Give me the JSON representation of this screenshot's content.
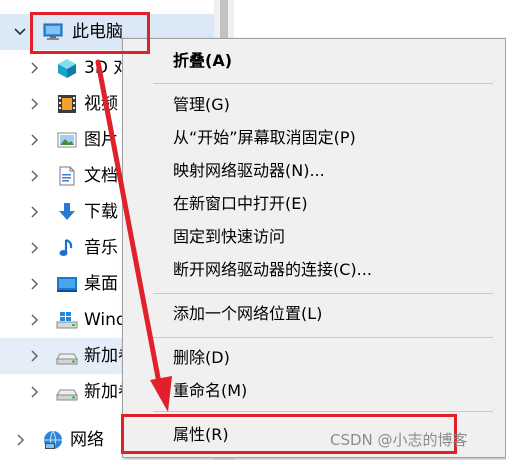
{
  "nav_tree": {
    "root": {
      "label": "此电脑",
      "icon": "computer-icon"
    },
    "items": [
      {
        "label": "3D 对象",
        "icon": "3d-objects-icon"
      },
      {
        "label": "视频",
        "icon": "video-icon"
      },
      {
        "label": "图片",
        "icon": "pictures-icon"
      },
      {
        "label": "文档",
        "icon": "documents-icon"
      },
      {
        "label": "下载",
        "icon": "download-icon"
      },
      {
        "label": "音乐",
        "icon": "music-icon"
      },
      {
        "label": "桌面",
        "icon": "desktop-icon"
      },
      {
        "label": "Windows",
        "icon": "windows-drive-icon"
      },
      {
        "label": "新加卷",
        "icon": "drive-icon"
      },
      {
        "label": "新加卷",
        "icon": "drive-icon"
      }
    ],
    "network": {
      "label": "网络",
      "icon": "network-icon"
    }
  },
  "context_menu": {
    "collapse": "折叠(A)",
    "manage": "管理(G)",
    "unpin_start": "从“开始”屏幕取消固定(P)",
    "map_drive": "映射网络驱动器(N)...",
    "open_new_window": "在新窗口中打开(E)",
    "pin_quick_access": "固定到快速访问",
    "disconnect_drive": "断开网络驱动器的连接(C)...",
    "add_network_location": "添加一个网络位置(L)",
    "delete": "删除(D)",
    "rename": "重命名(M)",
    "properties": "属性(R)"
  },
  "annotation": {
    "color": "#e0202a"
  },
  "watermark": "CSDN @小志的博客"
}
